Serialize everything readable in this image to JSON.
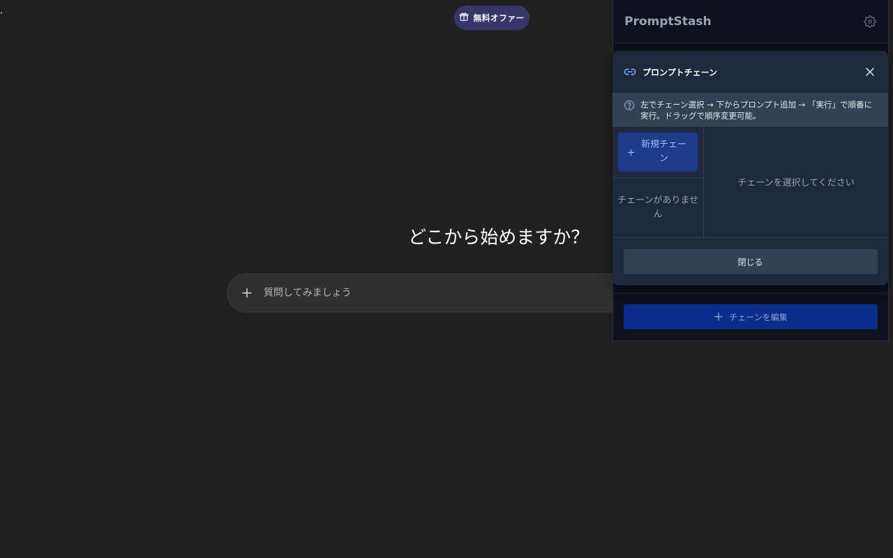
{
  "page": {
    "edge_glyph": "’",
    "offer_button": {
      "label": "無料オファー",
      "icon": "gift-icon"
    },
    "greeting": "どこから始めますか？",
    "composer": {
      "placeholder": "質問してみましょう",
      "value": "",
      "plus_icon": "plus-icon"
    }
  },
  "extension": {
    "title": "PromptStash",
    "settings_icon": "gear-icon",
    "edit_chain_button": {
      "label": "チェーンを編集",
      "icon": "plus-icon"
    }
  },
  "modal": {
    "title": "プロンプトチェーン",
    "title_icon": "link-icon",
    "close_icon": "close-icon",
    "hint": "左でチェーン選択 → 下からプロンプト追加 → 「実行」で順番に実行。ドラッグで順序変更可能。",
    "new_chain_button": "新規チェーン",
    "empty_chains": "チェーンがありません",
    "select_prompt": "チェーンを選択してください",
    "close_button": "閉じる"
  },
  "colors": {
    "page_bg": "#212121",
    "offer_pill": "#373669",
    "sidebar_bg": "#0c111b",
    "modal_bg": "#1e293b",
    "hint_bg": "#334155",
    "accent_blue": "#93c5fd",
    "primary_button": "#0a2c8a"
  }
}
